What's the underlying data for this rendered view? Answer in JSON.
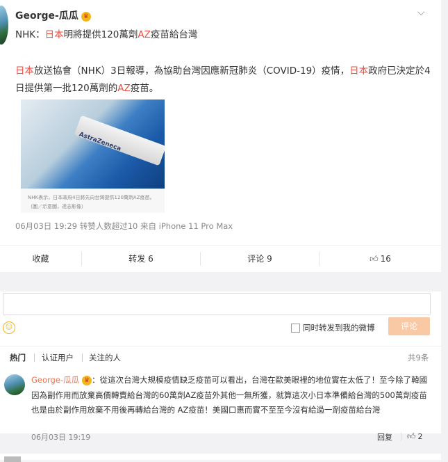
{
  "post": {
    "username": "George-瓜瓜",
    "title_parts": [
      "NHK：",
      "日本",
      "明將提供120萬劑",
      "AZ",
      "疫苗給台灣"
    ],
    "body_parts": [
      "日本",
      "放送協會（NHK）3日報導，為協助台灣因應新冠肺炎（COVID-19）疫情，",
      "日本",
      "政府已決定於4日提供第一批120萬劑的",
      "AZ",
      "疫苗。"
    ],
    "photo": {
      "label": "AstraZeneca",
      "caption": "NHK表示，日本政府4日將先向台灣提供120萬劑AZ疫苗。（圖／示意圖，達志影像）"
    },
    "meta": "06月03日 19:29 转赞人数超过10  来自 iPhone 11 Pro Max"
  },
  "actions": {
    "collect": "收藏",
    "repost": "转发 6",
    "comment": "评论 9",
    "like": "16"
  },
  "compose": {
    "also_repost": "同时转发到我的微博",
    "submit": "评论"
  },
  "tabs": {
    "hot": "热门",
    "verified": "认证用户",
    "following": "关注的人",
    "count": "共9条"
  },
  "comment": {
    "user": "George-瓜瓜",
    "text": "：從這次台灣大規模疫情缺乏疫苗可以看出，台灣在歐美眼裡的地位實在太低了！至今除了韓國因為副作用而放棄高價轉賣給台灣的60萬劑AZ疫苗外其他一無所獲，就算這次小日本準備給台灣的500萬劑疫苗也是由於副作用放棄不用後再轉給台灣的 AZ疫苗！美國口惠而實不至至今沒有給過一劑疫苗給台灣",
    "time": "06月03日 19:19",
    "reply": "回复",
    "likes": "2"
  },
  "icons": {
    "vip": "vip-badge-icon",
    "chevron": "chevron-down-icon",
    "like": "thumb-up-icon",
    "emoji": "smiley-icon"
  },
  "colors": {
    "highlight": "#eb4b3e",
    "link": "#eb7350",
    "submit_bg": "#f9c9a6"
  }
}
